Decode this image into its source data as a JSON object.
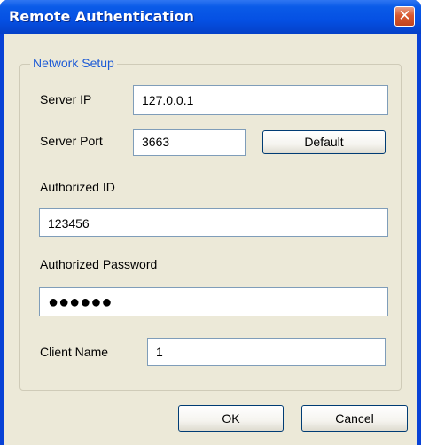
{
  "window": {
    "title": "Remote Authentication"
  },
  "network_setup": {
    "legend": "Network Setup",
    "server_ip": {
      "label": "Server IP",
      "value": "127.0.0.1"
    },
    "server_port": {
      "label": "Server Port",
      "value": "3663"
    },
    "default_button": "Default",
    "authorized_id": {
      "label": "Authorized ID",
      "value": "123456"
    },
    "authorized_password": {
      "label": "Authorized Password",
      "masked_value": "●●●●●●"
    },
    "client_name": {
      "label": "Client Name",
      "value": "1"
    }
  },
  "buttons": {
    "ok": "OK",
    "cancel": "Cancel"
  },
  "icons": {
    "close": "close-icon"
  }
}
